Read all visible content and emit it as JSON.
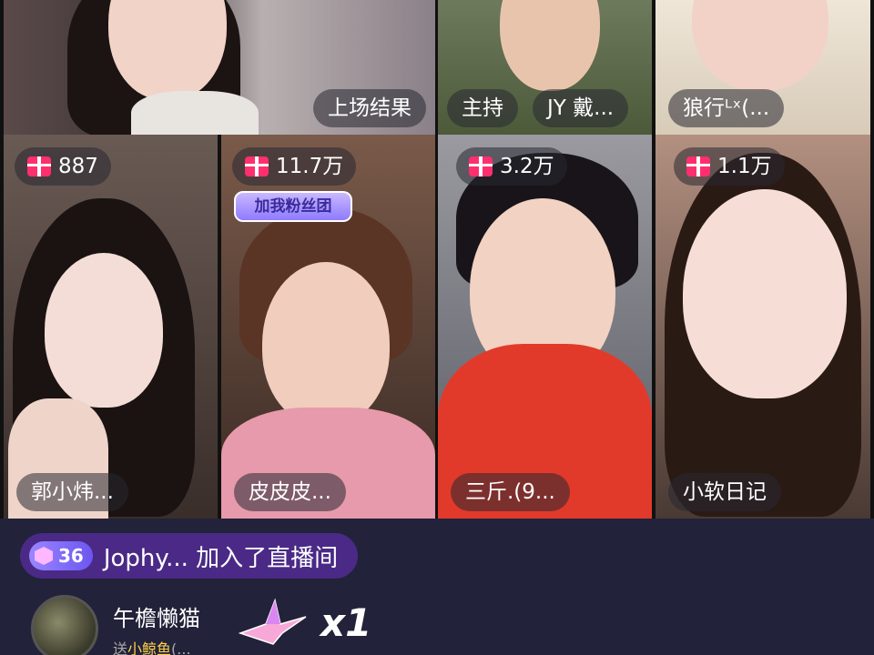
{
  "tiles": {
    "top_wide": {
      "name": "上场结果"
    },
    "top3": {
      "name": "JY 戴..."
    },
    "top3_host": {
      "role": "主持"
    },
    "top4": {
      "name": "狼行ᴸˣ(..."
    },
    "t1": {
      "gift": "887",
      "name": "郭小炜..."
    },
    "t2": {
      "gift": "11.7万",
      "name": "皮皮皮...",
      "sticker": "加我粉丝团"
    },
    "t3": {
      "gift": "3.2万",
      "name": "三斤.(9..."
    },
    "t4": {
      "gift": "1.1万",
      "name": "小软日记"
    }
  },
  "chat": {
    "join": {
      "level": "36",
      "text": "Jophy... 加入了直播间"
    },
    "gift": {
      "sender": "午檐懒猫",
      "prefix": "送",
      "gift_name": "小鲸鱼",
      "suffix": "(...",
      "count": "x1"
    }
  },
  "colors": {
    "gift_icon": "#ff2f6e",
    "join_banner": "#4a2a86",
    "background": "#22223a"
  },
  "icons": {
    "gift": "gift-box-icon",
    "level": "level-hexagon-icon",
    "crane": "paper-crane-gift-icon"
  }
}
